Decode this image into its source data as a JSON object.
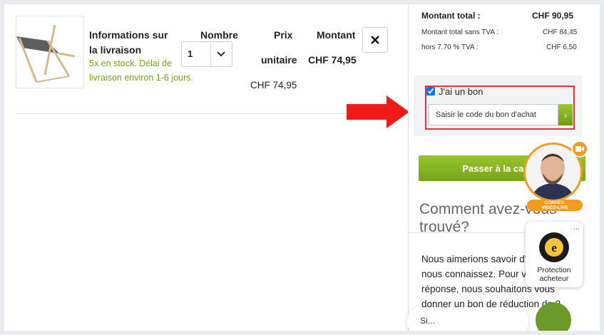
{
  "cart": {
    "delivery_title": "Informations sur la livraison",
    "stock_line1": "5x en stock. Délai de",
    "stock_line2": "livraison environ 1-6 jours.",
    "quantity_header": "Nombre",
    "price_header_1": "Prix",
    "price_header_2": "unitaire",
    "amount_header": "Montant",
    "quantity_value": "1",
    "unit_price": "CHF 74,95",
    "amount": "CHF 74,95"
  },
  "summary": {
    "total_label": "Montant total :",
    "total_value": "CHF 90,95",
    "net_label": "Montant total sans TVA :",
    "net_value": "CHF 84,45",
    "vat_label": "hors 7.70 % TVA :",
    "vat_value": "CHF 6,50"
  },
  "coupon": {
    "checkbox_label": "J'ai un bon",
    "input_placeholder": "Saisir le code du bon d'achat"
  },
  "checkout_button": "Passer à la caisse",
  "feedback": {
    "heading": "Comment avez-vous trouvé?",
    "body": "Nous aimerions savoir d'où vous nous connaissez. Pour votre réponse, nous souhaitons vous donner un bon de réduction de 2 CHF."
  },
  "video": {
    "label_line1": "CONSEIL",
    "label_line2": "VIDÉO-LIVE"
  },
  "trusted": {
    "label": "Protection acheteur",
    "menu_dots": "..."
  },
  "chat_preview": "Si...",
  "colors": {
    "accent_green": "#7aa31b",
    "highlight_red": "#e5323b",
    "video_orange": "#f39b1f"
  }
}
